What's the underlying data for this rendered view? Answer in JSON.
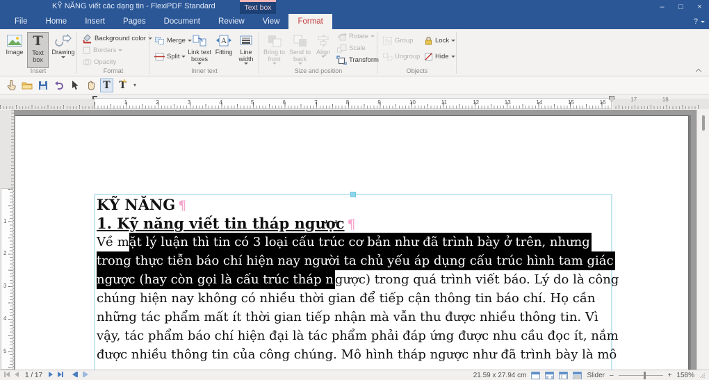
{
  "window": {
    "title": "KỸ NĂNG viết các dạng tin - FlexiPDF Standard",
    "contextual_tab": "Text box",
    "minimize": "–",
    "maximize": "□",
    "close": "×",
    "help": "?"
  },
  "menu": {
    "tabs": [
      {
        "label": "File"
      },
      {
        "label": "Home"
      },
      {
        "label": "Insert"
      },
      {
        "label": "Pages"
      },
      {
        "label": "Document"
      },
      {
        "label": "Review"
      },
      {
        "label": "View"
      },
      {
        "label": "Format"
      }
    ],
    "active_tab": "Format"
  },
  "ribbon": {
    "groups": {
      "insert": {
        "label": "Insert",
        "image": "Image",
        "textbox1": "Text",
        "textbox2": "box",
        "textbox_glyph": "T",
        "drawing": "Drawing"
      },
      "format": {
        "label": "Format",
        "background_color": "Background color",
        "borders": "Borders",
        "opacity": "Opacity"
      },
      "inner_text": {
        "label": "Inner text",
        "merge": "Merge",
        "split": "Split",
        "link1": "Link text",
        "link2": "boxes",
        "fitting": "Fitting",
        "linewidth1": "Line",
        "linewidth2": "width",
        "fitting_glyph": "A"
      },
      "size_position": {
        "label": "Size and position",
        "bring1": "Bring to",
        "bring2": "front",
        "send1": "Send to",
        "send2": "back",
        "align": "Align",
        "rotate": "Rotate",
        "scale": "Scale",
        "transform": "Transform"
      },
      "objects": {
        "label": "Objects",
        "group": "Group",
        "ungroup": "Ungroup",
        "lock": "Lock",
        "hide": "Hide"
      }
    }
  },
  "toolbar": {
    "text_tool_glyph": "T",
    "add_text_glyph": "T",
    "add_text_plus": "+",
    "more_glyph": "▾"
  },
  "rulers": {
    "horizontal_active_numbers": [
      1,
      2,
      3,
      4,
      5,
      6,
      7,
      8,
      9,
      10,
      11,
      12,
      13,
      14,
      15,
      16
    ],
    "horizontal_outside_numbers": [
      17,
      18
    ],
    "vertical_numbers": [
      1,
      2,
      3,
      4,
      5
    ]
  },
  "document": {
    "heading1": "KỸ NĂNG",
    "heading2": "1. Kỹ năng viết tin tháp ngược",
    "pilcrow": "¶",
    "body_lines": [
      [
        {
          "t": "Về m"
        },
        {
          "t": "ặt lý luận thì tin có 3 loại cấu trúc cơ bản như đã trình bày ở trên, nhưng",
          "sel": true
        }
      ],
      [
        {
          "t": "trong thực tiễn báo chí hiện nay người ta chủ yếu áp dụng cấu trúc hình tam giác",
          "sel": true
        }
      ],
      [
        {
          "t": "ngược (hay còn gọi là cấu trúc tháp n",
          "sel": true
        },
        {
          "t": "gược) trong quá trình viết báo. Lý do là công"
        }
      ],
      [
        {
          "t": "chúng hiện nay không có nhiều thời gian để tiếp cận thông tin báo chí. Họ cần"
        }
      ],
      [
        {
          "t": "những tác phẩm mất ít thời gian tiếp nhận mà vẫn thu được nhiều thông tin. Vì"
        }
      ],
      [
        {
          "t": "vậy, tác phẩm báo chí hiện đại là tác phẩm phải đáp ứng được nhu cầu đọc ít, nắm"
        }
      ],
      [
        {
          "t": "được nhiều thông tin của công chúng. Mô hình tháp ngược như đã trình bày là mô"
        }
      ]
    ]
  },
  "statusbar": {
    "page_indicator": "1 / 17",
    "page_size": "21.59 x 27.94 cm",
    "slider_label": "Slider",
    "zoom_out": "–",
    "zoom_in": "+",
    "zoom_level": "158%"
  },
  "colors": {
    "titlebar_blue": "#2b5797",
    "contextual_tab_blue": "#1d4176",
    "contextual_tab_border_pink": "#f3b4b7",
    "active_tab_red": "#c23b3b",
    "selection_bg": "#000000",
    "textbox_border_cyan": "#c3e6f2",
    "pilcrow_pink": "#f7a8cf"
  }
}
